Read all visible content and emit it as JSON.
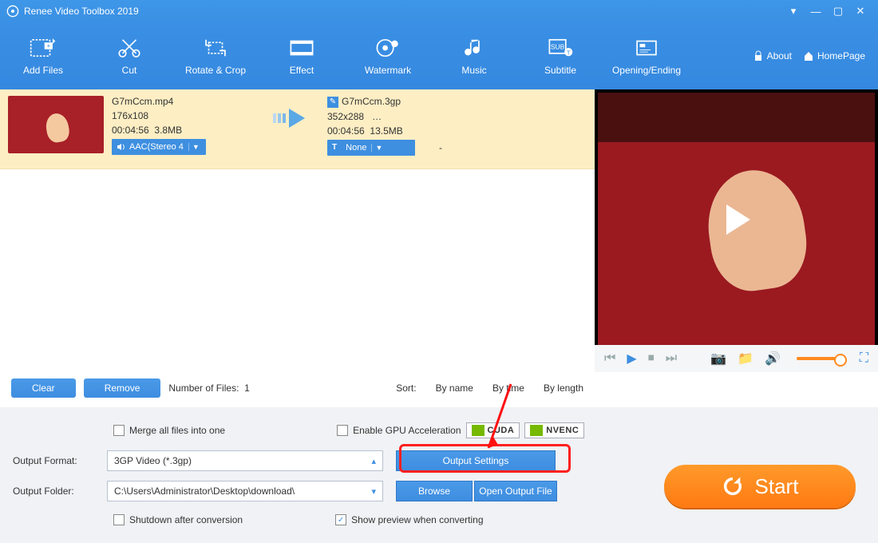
{
  "window": {
    "title": "Renee Video Toolbox 2019"
  },
  "toolbar": {
    "items": [
      {
        "label": "Add Files"
      },
      {
        "label": "Cut"
      },
      {
        "label": "Rotate & Crop"
      },
      {
        "label": "Effect"
      },
      {
        "label": "Watermark"
      },
      {
        "label": "Music"
      },
      {
        "label": "Subtitle"
      },
      {
        "label": "Opening/Ending"
      }
    ],
    "about": "About",
    "homepage": "HomePage"
  },
  "file": {
    "src": {
      "name": "G7mCcm.mp4",
      "dim": "176x108",
      "dur": "00:04:56",
      "size": "3.8MB",
      "audio": "AAC(Stereo 4"
    },
    "dst": {
      "name": "G7mCcm.3gp",
      "dim": "352x288",
      "more": "…",
      "dur": "00:04:56",
      "size": "13.5MB",
      "sub": "None"
    },
    "dash": "-"
  },
  "mid": {
    "clear": "Clear",
    "remove": "Remove",
    "count_label": "Number of Files:",
    "count": "1",
    "sort": "Sort:",
    "byname": "By name",
    "bytime": "By time",
    "bylength": "By length"
  },
  "opts": {
    "merge": "Merge all files into one",
    "gpu": "Enable GPU Acceleration",
    "cuda": "CUDA",
    "nvenc": "NVENC",
    "format_label": "Output Format:",
    "format_value": "3GP Video (*.3gp)",
    "output_settings": "Output Settings",
    "folder_label": "Output Folder:",
    "folder_value": "C:\\Users\\Administrator\\Desktop\\download\\",
    "browse": "Browse",
    "openfolder": "Open Output File",
    "shutdown": "Shutdown after conversion",
    "preview": "Show preview when converting",
    "start": "Start"
  }
}
